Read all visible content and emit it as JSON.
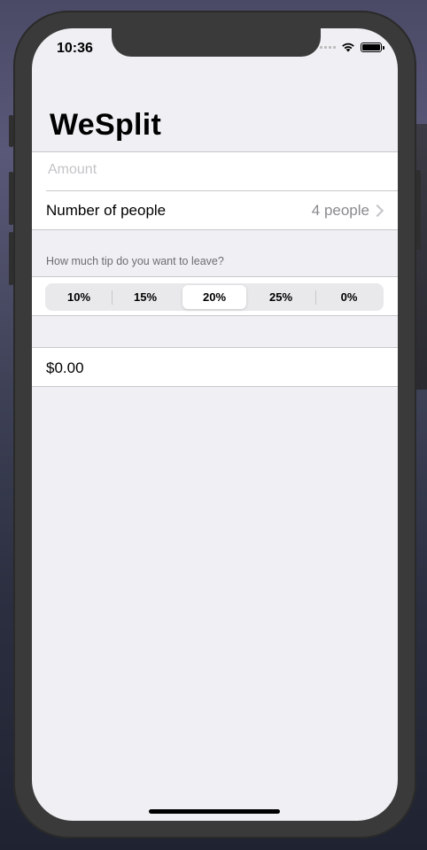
{
  "status_bar": {
    "time": "10:36",
    "icons": [
      "signal-icon",
      "wifi-icon",
      "battery-icon"
    ]
  },
  "nav": {
    "title": "WeSplit"
  },
  "form": {
    "amount": {
      "placeholder": "Amount",
      "value": ""
    },
    "people": {
      "label": "Number of people",
      "value": "4 people"
    },
    "tip_header": "How much tip do you want to leave?",
    "tip_options": [
      "10%",
      "15%",
      "20%",
      "25%",
      "0%"
    ],
    "tip_selected": "20%",
    "total": "$0.00"
  },
  "colors": {
    "background": "#efeff4",
    "secondary_text": "#8a8a8e",
    "separator": "#c8c7cc"
  }
}
